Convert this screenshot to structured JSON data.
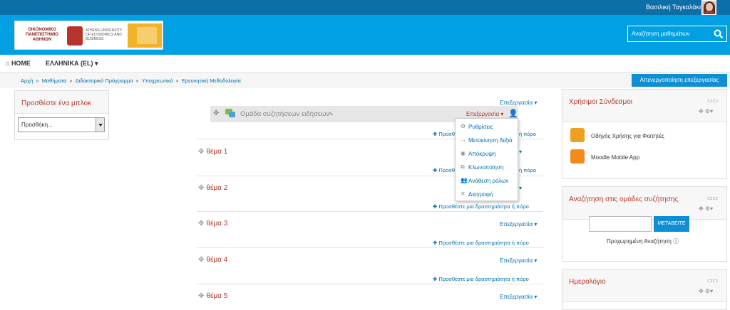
{
  "topbar": {
    "user_name": "Βασιλική Ταγκαλάκη"
  },
  "header": {
    "logo_text_gr": "ΟΙΚΟΝΟΜΙΚΟ ΠΑΝΕΠΙΣΤΗΜΙΟ ΑΘΗΝΩΝ",
    "logo_text_en": "ATHENS UNIVERSITY OF ECONOMICS AND BUSINESS",
    "search_placeholder": "Αναζήτηση μαθημάτων"
  },
  "navbar": {
    "home": "HOME",
    "language": "ΕΛΛΗΝΙΚΑ (EL)"
  },
  "breadcrumb": [
    "Αρχή",
    "Μαθήματα",
    "Διδακτορικό Πρόγραμμα",
    "Υποχρεωτικά",
    "Ερευνητική Μεθοδολογία"
  ],
  "edit_toggle": "Απενεργοποίηση επεξεργασίας",
  "left_block": {
    "title": "Προσθέστε ένα μπλοκ",
    "select_value": "Προσθήκη..."
  },
  "main": {
    "edit_label": "Επεξεργασία",
    "add_activity": "Προσθέστε μια δραστηριότητα ή πόρο",
    "add_activity_short": "Προσθ",
    "add_activity_tail": "ή πόρο",
    "forum_name": "Ομάδα συζητήσεων ειδήσεων",
    "topics": [
      "θέμα 1",
      "θέμα 2",
      "θέμα 3",
      "θέμα 4",
      "θέμα 5"
    ]
  },
  "menu": {
    "items": [
      "Ρυθμίσεις",
      "Μετακίνηση δεξιά",
      "Απόκρυψη",
      "Κλωνοποίηση",
      "Ανάθεση ρόλων",
      "Διαγραφή"
    ]
  },
  "right_blocks": {
    "links_title": "Χρήσιμοι Σύνδεσμοι",
    "links": [
      "Οδηγός Χρήσης για Φοιτητές",
      "Moodle Mobile App"
    ],
    "search_title": "Αναζήτηση στις ομάδες συζήτησης",
    "search_button": "ΜΕΤΑΒΕΙΤΕ",
    "advanced_search": "Προχωρημένη Αναζήτηση",
    "calendar_title": "Ημερολόγιο"
  },
  "colors": {
    "topbar": "#0e6fa8",
    "header": "#00a0e3",
    "accent_red": "#b23a2b",
    "link_blue": "#0070a8"
  }
}
